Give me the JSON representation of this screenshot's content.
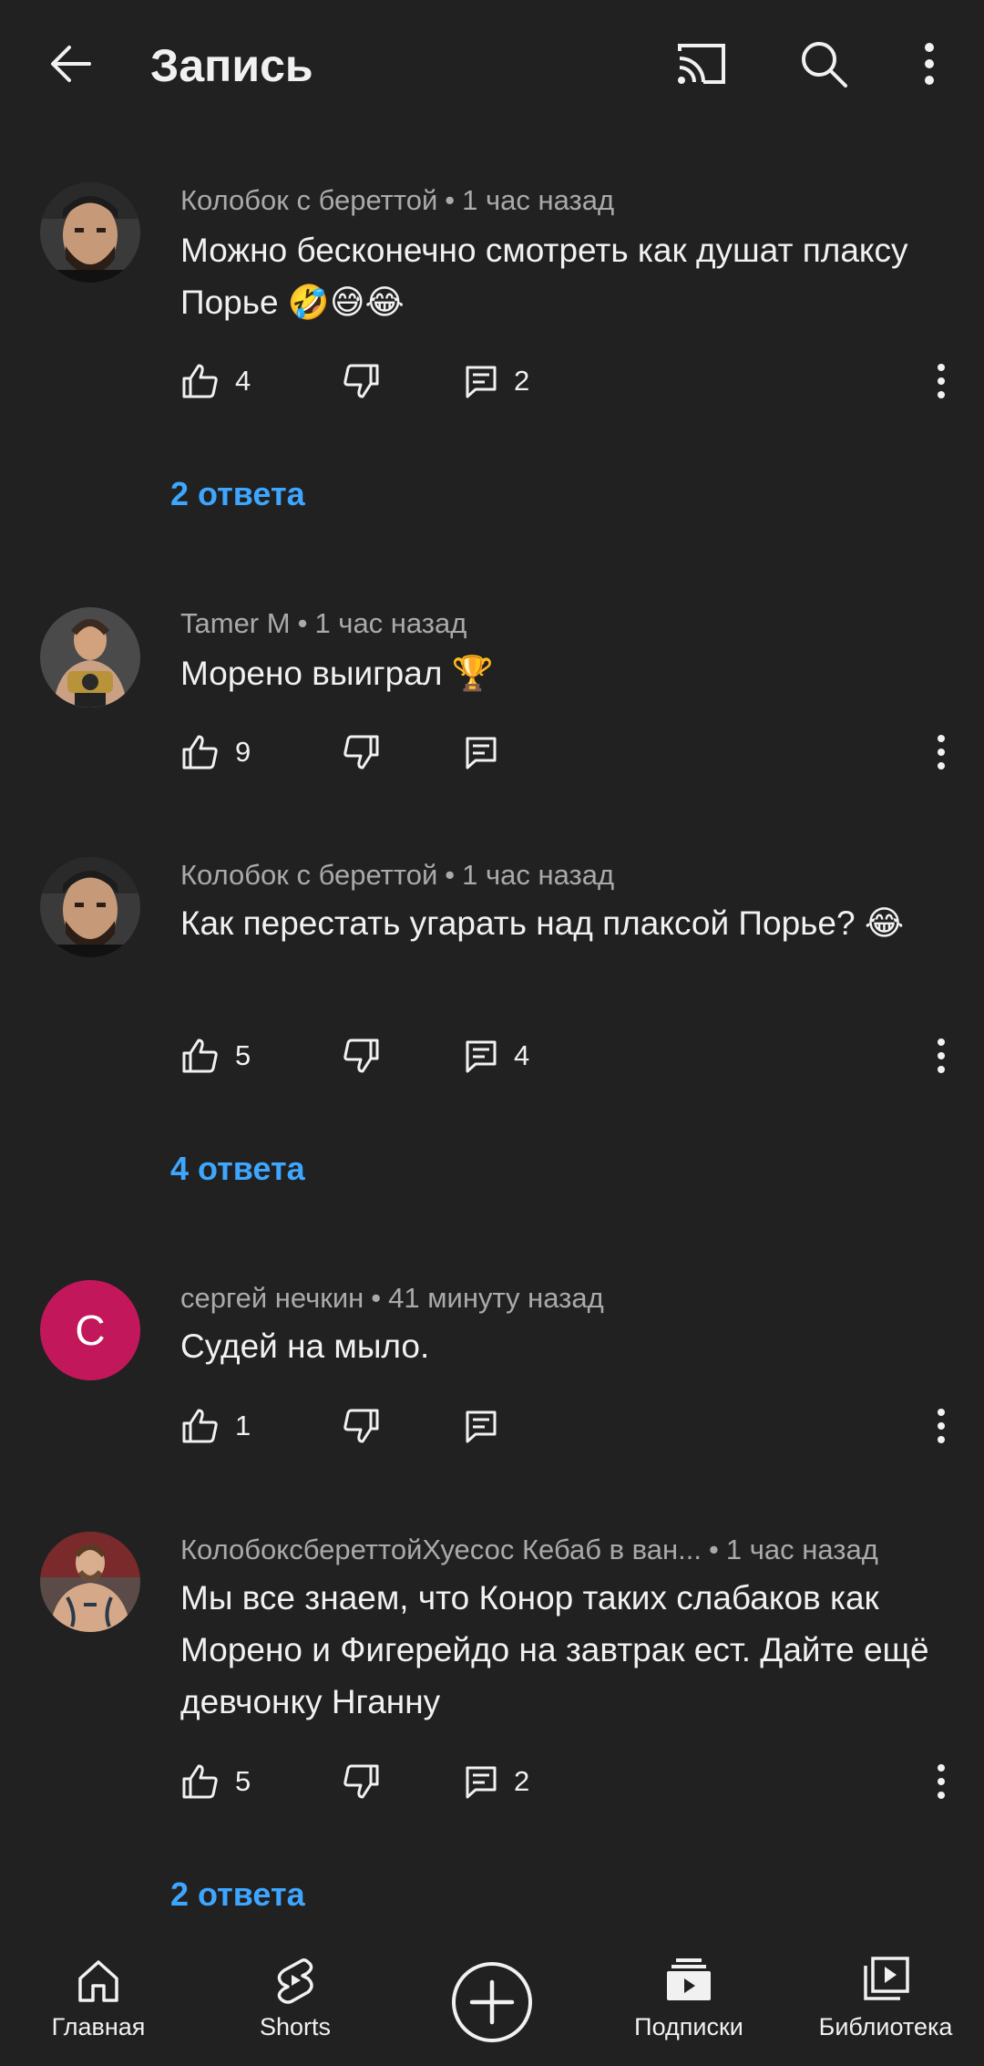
{
  "header": {
    "title": "Запись",
    "icons": [
      "back-arrow-icon",
      "cast-icon",
      "search-icon",
      "more-vert-icon"
    ]
  },
  "comments": [
    {
      "author": "Колобок с береттой",
      "time": "1 час назад",
      "text": "Можно бесконечно смотреть как душат плаксу Порье 🤣😅😂",
      "likes": "4",
      "replies_count": "2",
      "replies_link": "2 ответа",
      "avatar": "photo-bearded-man"
    },
    {
      "author": "Tamer M",
      "time": "1 час назад",
      "text": "Морено выиграл 🏆",
      "likes": "9",
      "replies_count": "",
      "replies_link": "",
      "avatar": "photo-fighter-with-belt"
    },
    {
      "author": "Колобок с береттой",
      "time": "1 час назад",
      "text": "Как перестать угарать над плаксой Порье? 😂",
      "likes": "5",
      "replies_count": "4",
      "replies_link": "4 ответа",
      "avatar": "photo-bearded-man"
    },
    {
      "author": "сергей нечкин",
      "time": "41 минуту назад",
      "text": "Судей на мыло.",
      "likes": "1",
      "replies_count": "",
      "replies_link": "",
      "avatar": "letter-avatar",
      "avatar_letter": "С",
      "avatar_color": "#c2185b"
    },
    {
      "author": "КолобоксбереттойХуесос Кебаб в ван...",
      "time": "1 час назад",
      "text": "Мы все знаем, что Конор таких слабаков как Морено и Фигерейдо на завтрак ест. Дайте ещё девчонку Нганну",
      "likes": "5",
      "replies_count": "2",
      "replies_link": "2 ответа",
      "avatar": "photo-tattooed-fighter"
    }
  ],
  "separator": "•",
  "bottom_nav": {
    "home": "Главная",
    "shorts": "Shorts",
    "create": "",
    "subscriptions": "Подписки",
    "library": "Библиотека"
  },
  "colors": {
    "background": "#212121",
    "text": "#f1f1f1",
    "secondary_text": "#aaaaaa",
    "link": "#3ea6ff"
  }
}
